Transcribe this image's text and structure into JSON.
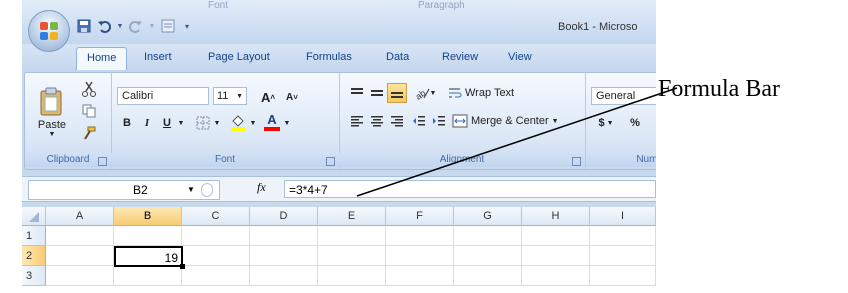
{
  "title_bar": {
    "ghost_labels": [
      "Font",
      "Paragraph"
    ],
    "document_title": "Book1 - Microso"
  },
  "tabs": [
    "Home",
    "Insert",
    "Page Layout",
    "Formulas",
    "Data",
    "Review",
    "View"
  ],
  "active_tab": "Home",
  "ribbon": {
    "clipboard": {
      "label": "Clipboard",
      "paste_label": "Paste"
    },
    "font": {
      "label": "Font",
      "font_name": "Calibri",
      "font_size": "11",
      "grow_label": "A",
      "shrink_label": "A",
      "bold": "B",
      "italic": "I",
      "underline": "U",
      "font_color_letter": "A"
    },
    "alignment": {
      "label": "Alignment",
      "wrap_text": "Wrap Text",
      "merge_center": "Merge & Center"
    },
    "number": {
      "label": "Numb",
      "format": "General",
      "currency": "$",
      "percent": "%"
    }
  },
  "formula_bar": {
    "name_box": "B2",
    "fx_label": "fx",
    "formula": "=3*4+7"
  },
  "grid": {
    "columns": [
      "A",
      "B",
      "C",
      "D",
      "E",
      "F",
      "G",
      "H",
      "I"
    ],
    "rows": [
      "1",
      "2",
      "3"
    ],
    "selected_column": "B",
    "selected_row": "2",
    "active_cell_value": "19"
  },
  "annotation": {
    "label": "Formula Bar"
  },
  "colors": {
    "ribbon_blue": "#c8d9ee",
    "tab_text": "#15428b",
    "selected_header": "#f8cc73"
  }
}
